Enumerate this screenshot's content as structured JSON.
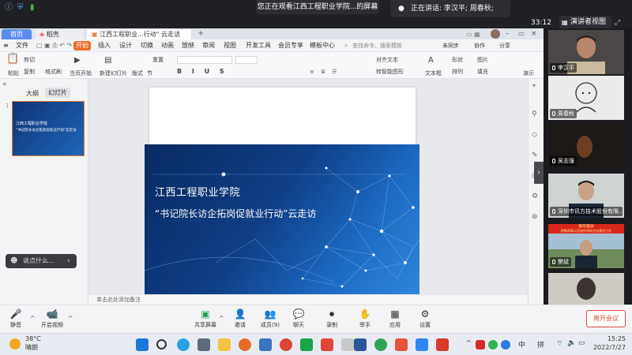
{
  "top_bar": {
    "sharing_notice": "您正在观看江西工程职业学院...的屏幕",
    "speaking_label": "正在讲话: 李汉平; 周春秋;",
    "timer": "33:12",
    "view_mode_label": "演讲者视图"
  },
  "wps": {
    "tabs": [
      "首页",
      "稻壳",
      "江西工程职业...行动\" 云走访"
    ],
    "new_tab": "+",
    "menu": {
      "file": "文件",
      "start": "开始",
      "items": [
        "插入",
        "设计",
        "切换",
        "动画",
        "放映",
        "审阅",
        "视图",
        "开发工具",
        "会员专享",
        "模板中心"
      ],
      "search_placeholder": "查找命令、搜索模板",
      "unsync": "未同步",
      "collab": "协作",
      "share": "分享"
    },
    "ribbon": {
      "paste": "粘贴",
      "cut": "剪切",
      "copy": "复制",
      "format_brush": "格式刷",
      "from_current": "当页开始",
      "new_slide": "新建幻灯片",
      "layout": "版式",
      "section": "节",
      "reset": "重置",
      "align_text": "对齐文本",
      "to_smartart": "转智能图形",
      "textbox": "文本框",
      "shape": "形状",
      "arrange": "排列",
      "image": "图片",
      "fill": "填充",
      "slideshow": "演示"
    },
    "panel_tabs": [
      "大纲",
      "幻灯片"
    ],
    "notes_placeholder": "单击此处添加备注"
  },
  "slide": {
    "number": "1",
    "title": "江西工程职业学院",
    "subtitle": "“书记院长访企拓岗促就业行动”云走访"
  },
  "chat": {
    "placeholder": "说点什么..."
  },
  "participants": [
    {
      "name": "李汉平"
    },
    {
      "name": "周春秋"
    },
    {
      "name": "吴志强"
    },
    {
      "name": "深圳市讯方技术股份有限..."
    },
    {
      "name": "樊斌",
      "banner_line1": "狼泉盛会",
      "banner_line2": "职教改革示范校传承现代化建设工作"
    },
    {
      "name": ""
    }
  ],
  "controls": {
    "mute": "静音",
    "video": "开启视频",
    "share_screen": "共享屏幕",
    "invite": "邀请",
    "members": "成员(9)",
    "chat": "聊天",
    "record": "录制",
    "raise_hand": "举手",
    "apps": "应用",
    "settings": "设置",
    "leave": "离开会议"
  },
  "taskbar": {
    "weather_temp": "38°C",
    "weather_desc": "晴朗",
    "ime_lang": "中",
    "ime_mode": "拼",
    "time": "15:25",
    "date": "2022/7/27"
  },
  "colors": {
    "wps_accent": "#f06a2a",
    "slide_blue": "#0e3f86",
    "leave_red": "#e14c42"
  }
}
